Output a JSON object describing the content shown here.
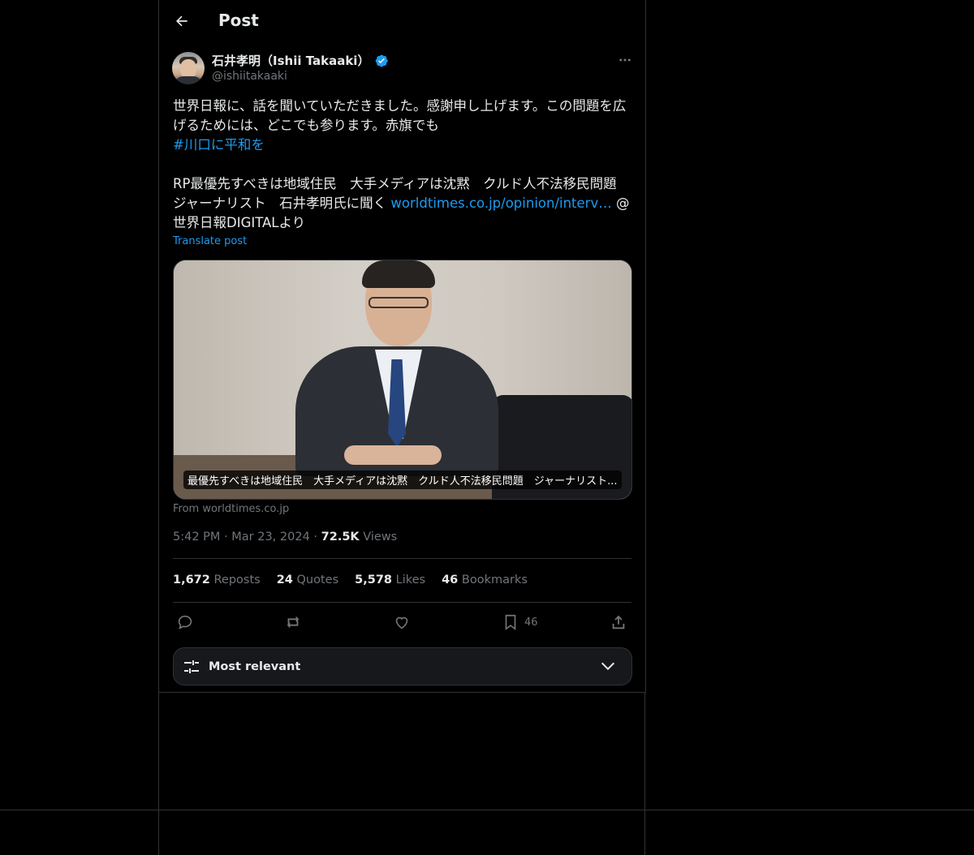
{
  "header": {
    "title": "Post"
  },
  "author": {
    "name": "石井孝明（Ishii Takaaki）",
    "handle": "@ishiitakaaki",
    "verified": true
  },
  "post": {
    "text_line1": "世界日報に、話を聞いていただきました。感謝申し上げます。この問題を広げるためには、どこでも参ります。赤旗でも",
    "hashtag": "#川口に平和を",
    "text_line2a": "RP最優先すべきは地域住民　大手メディアは沈黙　クルド人不法移民問題　ジャーナリスト　石井孝明氏に聞く ",
    "link": "worldtimes.co.jp/opinion/interv…",
    "text_line2b": " @世界日報DIGITALより",
    "translate": "Translate post"
  },
  "card": {
    "caption": "最優先すべきは地域住民　大手メディアは沈黙　クルド人不法移民問題　ジャーナリスト...",
    "source": "From worldtimes.co.jp"
  },
  "meta": {
    "time": "5:42 PM",
    "date": "Mar 23, 2024",
    "views_count": "72.5K",
    "views_label": " Views"
  },
  "stats": {
    "reposts_count": "1,672",
    "reposts_label": " Reposts",
    "quotes_count": "24",
    "quotes_label": " Quotes",
    "likes_count": "5,578",
    "likes_label": " Likes",
    "bookmarks_count": "46",
    "bookmarks_label": " Bookmarks"
  },
  "actions": {
    "bookmark_count": "46"
  },
  "sort": {
    "label": "Most relevant"
  },
  "colors": {
    "accent": "#1d9bf0",
    "background": "#000000",
    "muted": "#71767b",
    "border": "#2f3336"
  }
}
